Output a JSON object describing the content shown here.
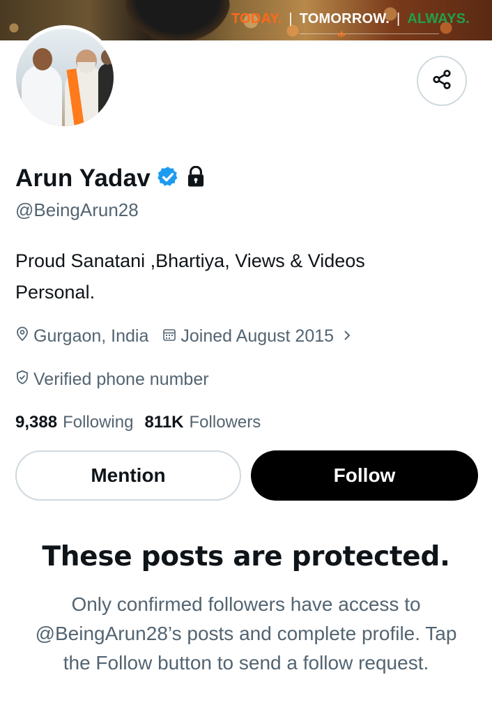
{
  "banner": {
    "tagline_today": "TODAY.",
    "tagline_tomorrow": "TOMORROW.",
    "tagline_always": "ALWAYS.",
    "separator": "|"
  },
  "profile": {
    "display_name": "Arun Yadav",
    "handle": "@BeingArun28",
    "bio_line1": "Proud Sanatani ,Bhartiya, Views & Videos",
    "bio_line2": "Personal.",
    "location": "Gurgaon, India",
    "joined": "Joined August 2015",
    "verified_phone": "Verified phone number"
  },
  "counts": {
    "following_value": "9,388",
    "following_label": "Following",
    "followers_value": "811K",
    "followers_label": "Followers"
  },
  "actions": {
    "mention_label": "Mention",
    "follow_label": "Follow"
  },
  "protected": {
    "title": "These posts are protected.",
    "body": "Only confirmed followers have access to @BeingArun28’s posts and complete profile. Tap the Follow button to send a follow request."
  },
  "icons": {
    "verified": "verified-badge-icon",
    "lock": "lock-icon",
    "share": "share-icon",
    "location": "location-pin-icon",
    "calendar": "calendar-icon",
    "chevron": "chevron-right-icon",
    "shield": "shield-check-icon"
  },
  "colors": {
    "verified_blue": "#1d9bf0",
    "text_primary": "#0f1419",
    "text_secondary": "#536471",
    "tag_orange": "#ff6a1a",
    "tag_green": "#22a04a"
  }
}
